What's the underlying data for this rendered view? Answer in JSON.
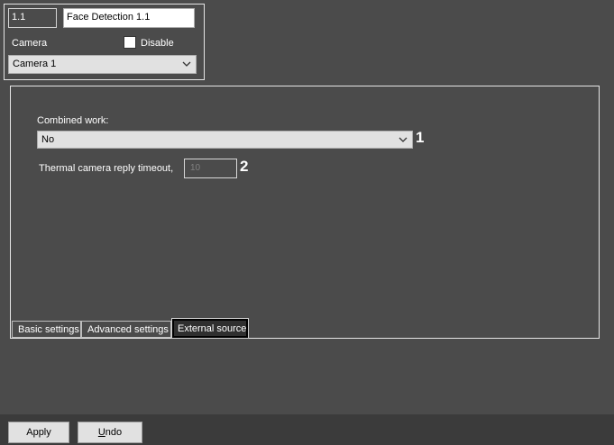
{
  "object": {
    "id_value": "1.1",
    "name_value": "Face Detection 1.1",
    "camera_label": "Camera",
    "disable_label": "Disable",
    "disable_checked": false,
    "camera_selected": "Camera 1"
  },
  "external_source": {
    "combined_label": "Combined work:",
    "combined_selected": "No",
    "thermal_label": "Thermal camera reply timeout,",
    "thermal_value": "10",
    "callout_1": "1",
    "callout_2": "2"
  },
  "tabs": [
    {
      "label": "Basic settings",
      "active": false
    },
    {
      "label": "Advanced settings",
      "active": false
    },
    {
      "label": "External source",
      "active": true
    }
  ],
  "footer": {
    "apply_label": "Apply",
    "undo_first": "U",
    "undo_rest": "ndo"
  }
}
